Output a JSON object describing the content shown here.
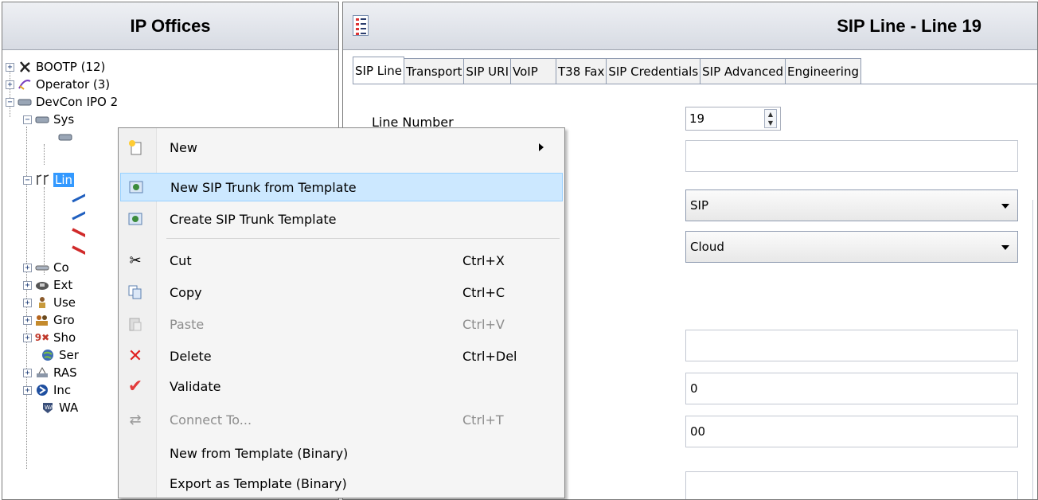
{
  "left": {
    "title": "IP Offices",
    "tree": [
      {
        "label": "BOOTP (12)"
      },
      {
        "label": "Operator (3)"
      },
      {
        "label": "DevCon IPO 2"
      },
      {
        "label": "Sys"
      },
      {
        "label": "Lin"
      },
      {
        "label": "Co"
      },
      {
        "label": "Ext"
      },
      {
        "label": "Use"
      },
      {
        "label": "Gro"
      },
      {
        "label": "Sho"
      },
      {
        "label": "Ser"
      },
      {
        "label": "RAS"
      },
      {
        "label": "Inc"
      },
      {
        "label": "WA"
      }
    ]
  },
  "right": {
    "title": "SIP Line - Line 19",
    "tabs": [
      {
        "label": "SIP Line"
      },
      {
        "label": "Transport"
      },
      {
        "label": "SIP URI"
      },
      {
        "label": "VoIP"
      },
      {
        "label": "T38 Fax"
      },
      {
        "label": "SIP Credentials"
      },
      {
        "label": "SIP Advanced"
      },
      {
        "label": "Engineering"
      }
    ],
    "fields": {
      "line_number_label": "Line Number",
      "line_number_value": "19",
      "field2_value": "",
      "select1_value": "SIP",
      "select2_value": "Cloud",
      "field5_value": "",
      "field6_value": "0",
      "field7_value": "00",
      "field8_value": ""
    }
  },
  "context_menu": {
    "items": [
      {
        "label": "New",
        "shortcut": "",
        "icon": "new-file-icon"
      },
      {
        "label": "New SIP Trunk from Template",
        "shortcut": "",
        "icon": "sip-template-icon"
      },
      {
        "label": "Create SIP Trunk Template",
        "shortcut": "",
        "icon": "sip-template-icon"
      },
      {
        "label": "Cut",
        "shortcut": "Ctrl+X",
        "icon": "scissors-icon"
      },
      {
        "label": "Copy",
        "shortcut": "Ctrl+C",
        "icon": "copy-icon"
      },
      {
        "label": "Paste",
        "shortcut": "Ctrl+V",
        "icon": "paste-icon"
      },
      {
        "label": "Delete",
        "shortcut": "Ctrl+Del",
        "icon": "delete-icon"
      },
      {
        "label": "Validate",
        "shortcut": "",
        "icon": "checkmark-icon"
      },
      {
        "label": "Connect To...",
        "shortcut": "Ctrl+T",
        "icon": "connect-icon"
      },
      {
        "label": "New from Template (Binary)",
        "shortcut": "",
        "icon": ""
      },
      {
        "label": "Export as Template (Binary)",
        "shortcut": "",
        "icon": ""
      }
    ]
  },
  "colors": {
    "selection": "#3399ff",
    "menu_highlight": "#cce8ff",
    "delete_red": "#e02020",
    "validate_red": "#e23b3b"
  }
}
